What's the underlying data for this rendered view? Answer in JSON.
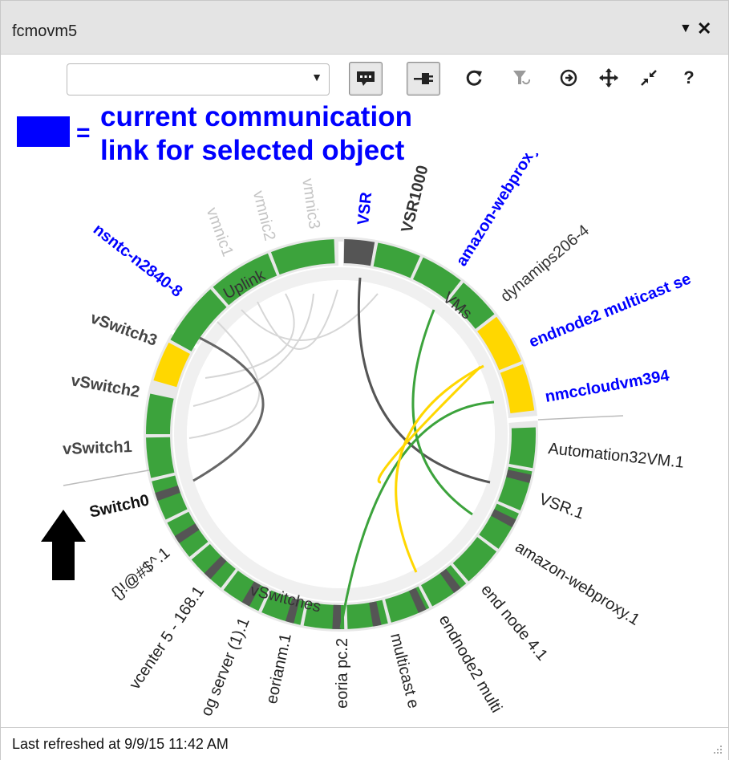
{
  "window": {
    "title": "fcmovm5",
    "menu_icon": "caret-down-icon",
    "close_icon": "close-icon"
  },
  "toolbar": {
    "filter_value": "",
    "buttons": [
      "comment-toggle-icon",
      "plug-toggle-icon",
      "refresh-icon",
      "filter-undo-icon",
      "navigate-icon",
      "move-icon",
      "collapse-icon",
      "help-icon"
    ]
  },
  "legend": {
    "line1": "current communication",
    "line2": "link for selected object",
    "equals": "=",
    "swatch_color": "#0000ff"
  },
  "diagram": {
    "groups": [
      "Uplink",
      "VMs",
      "vSwitches"
    ],
    "uplink_nodes": [
      "vmnic1",
      "vmnic2",
      "vmnic3"
    ],
    "vm_nodes": [
      "VSR",
      "VSR1000",
      "amazon-webproxy",
      "dynamips206-4",
      "endnode2 multicast se",
      "nmccloudvm394"
    ],
    "vswitch_nodes": [
      "Automation32VM.1",
      "VSR.1",
      "amazon-webproxy.1",
      "end node 4.1",
      "endnode2 multi",
      "multicast e",
      "eoria pc.2",
      "eorianm.1",
      "og server (1).1",
      "vcenter 5 - 168.1",
      "{}!@#$^.1",
      "Switch0",
      "vSwitch1",
      "vSwitch2",
      "vSwitch3",
      "nsntc-n2840-8"
    ],
    "colors": {
      "green": "#3ca33c",
      "yellow": "#ffd700",
      "dark": "#555555",
      "highlight": "#0000ff",
      "muted": "#c4c4c4"
    }
  },
  "status": {
    "refreshed": "Last refreshed at 9/9/15 11:42 AM"
  }
}
